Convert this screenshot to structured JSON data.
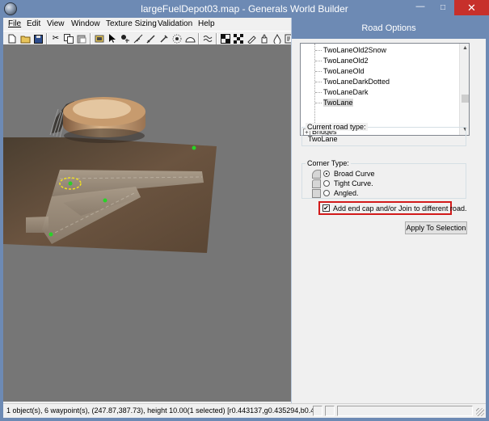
{
  "window": {
    "title": "largeFuelDepot03.map - Generals World Builder",
    "minimize_glyph": "—",
    "maximize_glyph": "□",
    "close_glyph": "✕"
  },
  "menu": [
    "File",
    "Edit",
    "View",
    "Window",
    "Texture Sizing",
    "Validation",
    "Help"
  ],
  "toolbar_icons": [
    "new-file-icon",
    "open-folder-icon",
    "save-icon",
    "cut-icon",
    "copy-icon",
    "paste-icon",
    "brush-tool-icon",
    "pointer-tool-icon",
    "waypoint-tool-icon",
    "feather-tool-icon",
    "tile-tool-icon",
    "eyedropper-tool-icon",
    "light-tool-icon",
    "half-circle-tool-icon",
    "waves-tool-icon",
    "checker-tool-icon",
    "mosaic-tool-icon",
    "paint-tool-icon",
    "hand-tool-icon",
    "drop-tool-icon",
    "script-tool-icon"
  ],
  "panel": {
    "title": "Road Options",
    "road_list": [
      "TwoLaneOld2Snow",
      "TwoLaneOld2",
      "TwoLaneOld",
      "TwoLaneDarkDotted",
      "TwoLaneDark",
      "TwoLane"
    ],
    "selected_road": "TwoLane",
    "tree_expander": "+",
    "tree_bridges": "Bridges",
    "current_road_label": "Current road type:",
    "current_road_value": "TwoLane",
    "corner_type_label": "Corner Type:",
    "corner_options": [
      "Broad Curve",
      "Tight Curve.",
      "Angled."
    ],
    "selected_corner": "Broad Curve",
    "endcap_label": "Add end cap and/or Join to different road.",
    "endcap_checked": true,
    "endcap_mark": "✔",
    "apply_button": "Apply To Selection"
  },
  "statusbar": {
    "text": "1 object(s), 6 waypoint(s), (247.87,387.73), height 10.00(1 selected) [r0.443137,g0.435294,b0.4..."
  },
  "colors": {
    "title_bar": "#6d8ab4",
    "close_button": "#c7302b",
    "viewport_bg": "#767676",
    "waypoint": "#28d228",
    "selection_ring": "#f0e020",
    "highlight_border": "#d21a1a"
  }
}
